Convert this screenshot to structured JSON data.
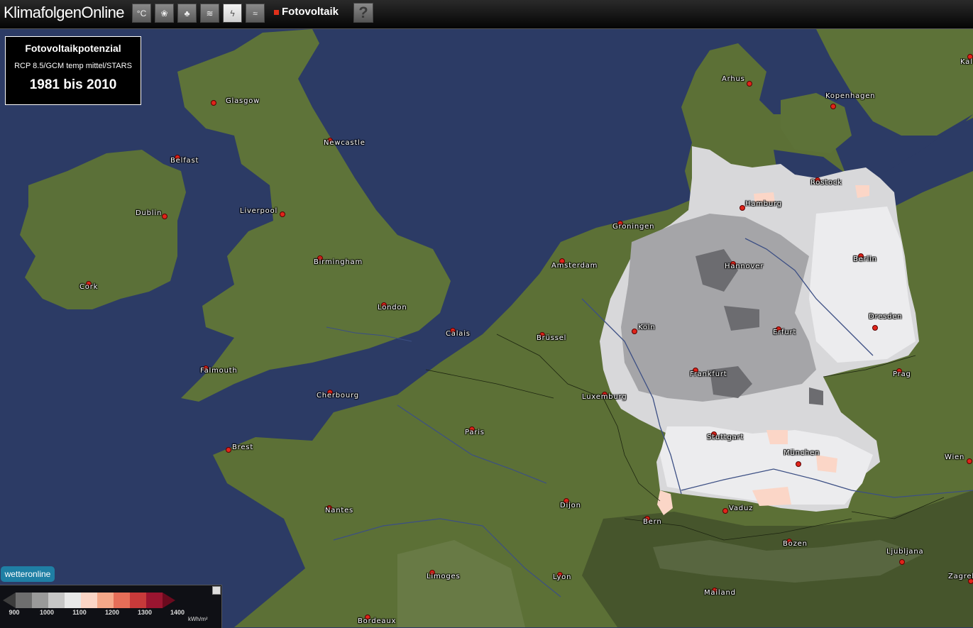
{
  "app": {
    "title": "KlimafolgenOnline",
    "active_layer": "Fotovoltaik",
    "toolbar": [
      {
        "name": "temperature-icon",
        "glyph": "°C"
      },
      {
        "name": "agriculture-icon",
        "glyph": "❀"
      },
      {
        "name": "forest-icon",
        "glyph": "♣"
      },
      {
        "name": "water-icon",
        "glyph": "≋"
      },
      {
        "name": "energy-icon",
        "glyph": "ϟ"
      },
      {
        "name": "tourism-icon",
        "glyph": "≈"
      }
    ],
    "help_label": "?"
  },
  "info": {
    "title": "Fotovoltaikpotenzial",
    "scenario": "RCP 8.5/GCM temp mittel/STARS",
    "period": "1981 bis 2010"
  },
  "cities": [
    {
      "name": "Glasgow",
      "dot": [
        301,
        145
      ],
      "lbl": [
        318,
        142
      ]
    },
    {
      "name": "Newcastle",
      "dot": [
        465,
        198
      ],
      "lbl": [
        456,
        201
      ]
    },
    {
      "name": "Belfast",
      "dot": [
        250,
        222
      ],
      "lbl": [
        240,
        226
      ]
    },
    {
      "name": "Dublin",
      "dot": [
        232,
        305
      ],
      "lbl": [
        191,
        300
      ]
    },
    {
      "name": "Liverpool",
      "dot": [
        398,
        302
      ],
      "lbl": [
        338,
        297
      ]
    },
    {
      "name": "Birmingham",
      "dot": [
        451,
        364
      ],
      "lbl": [
        442,
        369
      ]
    },
    {
      "name": "Cork",
      "dot": [
        125,
        400
      ],
      "lbl": [
        112,
        404
      ]
    },
    {
      "name": "London",
      "dot": [
        541,
        430
      ],
      "lbl": [
        532,
        433
      ]
    },
    {
      "name": "Falmouth",
      "dot": [
        290,
        519
      ],
      "lbl": [
        282,
        522
      ]
    },
    {
      "name": "Amsterdam",
      "dot": [
        792,
        368
      ],
      "lbl": [
        777,
        374
      ]
    },
    {
      "name": "Groningen",
      "dot": [
        874,
        315
      ],
      "lbl": [
        863,
        319
      ]
    },
    {
      "name": "Calais",
      "dot": [
        638,
        466
      ],
      "lbl": [
        628,
        470
      ]
    },
    {
      "name": "Brüssel",
      "dot": [
        764,
        472
      ],
      "lbl": [
        756,
        476
      ]
    },
    {
      "name": "Luxemburg",
      "dot": [
        852,
        556
      ],
      "lbl": [
        820,
        559
      ]
    },
    {
      "name": "Cherbourg",
      "dot": [
        465,
        553
      ],
      "lbl": [
        446,
        557
      ]
    },
    {
      "name": "Paris",
      "dot": [
        665,
        605
      ],
      "lbl": [
        655,
        609
      ]
    },
    {
      "name": "Brest",
      "dot": [
        322,
        634
      ],
      "lbl": [
        327,
        630
      ]
    },
    {
      "name": "Nantes",
      "dot": [
        464,
        716
      ],
      "lbl": [
        458,
        719
      ]
    },
    {
      "name": "Dijon",
      "dot": [
        798,
        706
      ],
      "lbl": [
        789,
        712
      ]
    },
    {
      "name": "Limoges",
      "dot": [
        609,
        807
      ],
      "lbl": [
        601,
        812
      ]
    },
    {
      "name": "Lyon",
      "dot": [
        789,
        810
      ],
      "lbl": [
        779,
        813
      ]
    },
    {
      "name": "Bordeaux",
      "dot": [
        518,
        870
      ],
      "lbl": [
        504,
        875
      ]
    },
    {
      "name": "Arhus",
      "dot": [
        1056,
        118
      ],
      "lbl": [
        1017,
        111
      ]
    },
    {
      "name": "Kopenhagen",
      "dot": [
        1174,
        150
      ],
      "lbl": [
        1163,
        135
      ]
    },
    {
      "name": "Rostock",
      "dot": [
        1152,
        254
      ],
      "lbl": [
        1142,
        257
      ]
    },
    {
      "name": "Hamburg",
      "dot": [
        1046,
        293
      ],
      "lbl": [
        1050,
        287
      ]
    },
    {
      "name": "Berlin",
      "dot": [
        1213,
        361
      ],
      "lbl": [
        1202,
        365
      ]
    },
    {
      "name": "Hannover",
      "dot": [
        1033,
        372
      ],
      "lbl": [
        1021,
        375
      ]
    },
    {
      "name": "Dresden",
      "dot": [
        1233,
        462
      ],
      "lbl": [
        1224,
        446
      ]
    },
    {
      "name": "Köln",
      "dot": [
        894,
        467
      ],
      "lbl": [
        899,
        461
      ]
    },
    {
      "name": "Erfurt",
      "dot": [
        1097,
        464
      ],
      "lbl": [
        1089,
        468
      ]
    },
    {
      "name": "Frankfurt",
      "dot": [
        980,
        522
      ],
      "lbl": [
        972,
        527
      ]
    },
    {
      "name": "Prag",
      "dot": [
        1267,
        523
      ],
      "lbl": [
        1258,
        527
      ]
    },
    {
      "name": "Stuttgart",
      "dot": [
        1006,
        612
      ],
      "lbl": [
        996,
        616
      ]
    },
    {
      "name": "München",
      "dot": [
        1125,
        654
      ],
      "lbl": [
        1104,
        638
      ]
    },
    {
      "name": "Wien",
      "dot": [
        1366,
        650
      ],
      "lbl": [
        1331,
        644
      ]
    },
    {
      "name": "Vaduz",
      "dot": [
        1022,
        720
      ],
      "lbl": [
        1027,
        716
      ]
    },
    {
      "name": "Bern",
      "dot": [
        912,
        731
      ],
      "lbl": [
        906,
        735
      ]
    },
    {
      "name": "Bozen",
      "dot": [
        1112,
        763
      ],
      "lbl": [
        1103,
        766
      ]
    },
    {
      "name": "Ljubljana",
      "dot": [
        1271,
        792
      ],
      "lbl": [
        1249,
        777
      ]
    },
    {
      "name": "Mailand",
      "dot": [
        1007,
        832
      ],
      "lbl": [
        992,
        835
      ]
    },
    {
      "name": "Zagreb",
      "dot": [
        1368,
        819
      ],
      "lbl": [
        1336,
        812
      ]
    },
    {
      "name": "Kal",
      "dot": [
        1367,
        80
      ],
      "lbl": [
        1353,
        87
      ]
    }
  ],
  "legend": {
    "unit": "kWh/m²",
    "ticks": [
      "900",
      "1000",
      "1100",
      "1200",
      "1300",
      "1400"
    ],
    "colors": [
      "#3c3c3c",
      "#6e6e6e",
      "#9a9a9a",
      "#c6c6c6",
      "#e8e8e8",
      "#fbd5c6",
      "#f4a889",
      "#e56e58",
      "#c73a3a",
      "#9a1530",
      "#6b0a1e"
    ]
  },
  "logo": "wetteronline"
}
